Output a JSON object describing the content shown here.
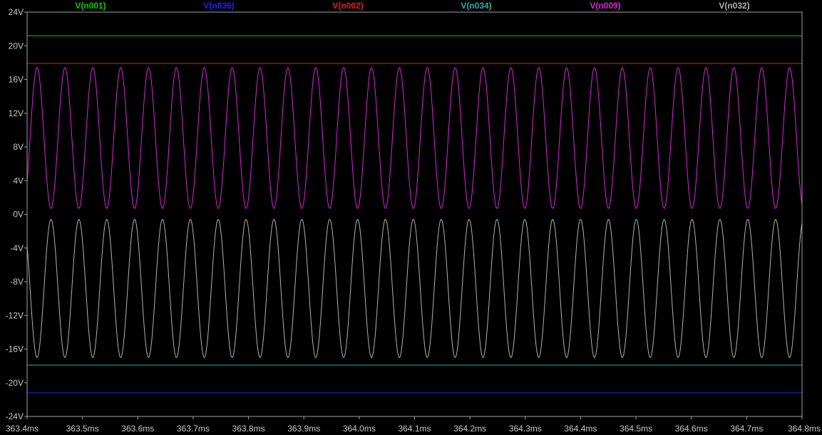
{
  "chart_data": {
    "type": "line",
    "xlabel": "",
    "ylabel": "",
    "xlim": [
      363.4,
      364.8
    ],
    "ylim": [
      -24,
      24
    ],
    "x_ticks": [
      "363.4ms",
      "363.5ms",
      "363.6ms",
      "363.7ms",
      "363.8ms",
      "363.9ms",
      "364.0ms",
      "364.1ms",
      "364.2ms",
      "364.3ms",
      "364.4ms",
      "364.5ms",
      "364.6ms",
      "364.7ms",
      "364.8ms"
    ],
    "x_tick_values": [
      363.4,
      363.5,
      363.6,
      363.7,
      363.8,
      363.9,
      364.0,
      364.1,
      364.2,
      364.3,
      364.4,
      364.5,
      364.6,
      364.7,
      364.8
    ],
    "y_ticks": [
      "24V",
      "20V",
      "16V",
      "12V",
      "8V",
      "4V",
      "0V",
      "-4V",
      "-8V",
      "-12V",
      "-16V",
      "-20V",
      "-24V"
    ],
    "y_tick_values": [
      24,
      20,
      16,
      12,
      8,
      4,
      0,
      -4,
      -8,
      -12,
      -16,
      -20,
      -24
    ],
    "grid": false,
    "legend_position": "top",
    "series": [
      {
        "name": "V(n001)",
        "color": "#00d000",
        "kind": "dc",
        "value": 21.2
      },
      {
        "name": "V(n036)",
        "color": "#2020ff",
        "kind": "dc",
        "value": -21.2
      },
      {
        "name": "V(n002)",
        "color": "#e02020",
        "kind": "dc",
        "value": 17.9
      },
      {
        "name": "V(n034)",
        "color": "#20b0b0",
        "kind": "dc",
        "value": -17.9
      },
      {
        "name": "V(n009)",
        "color": "#e020e0",
        "kind": "sine",
        "min": 0.7,
        "max": 17.4,
        "frequency_per_ms": 19.86,
        "first_peak_ms": 363.418
      },
      {
        "name": "V(n032)",
        "color": "#b0b0b0",
        "kind": "sine",
        "min": -17.0,
        "max": -0.6,
        "frequency_per_ms": 19.86,
        "first_peak_ms": 363.418,
        "inverted": true
      }
    ]
  }
}
